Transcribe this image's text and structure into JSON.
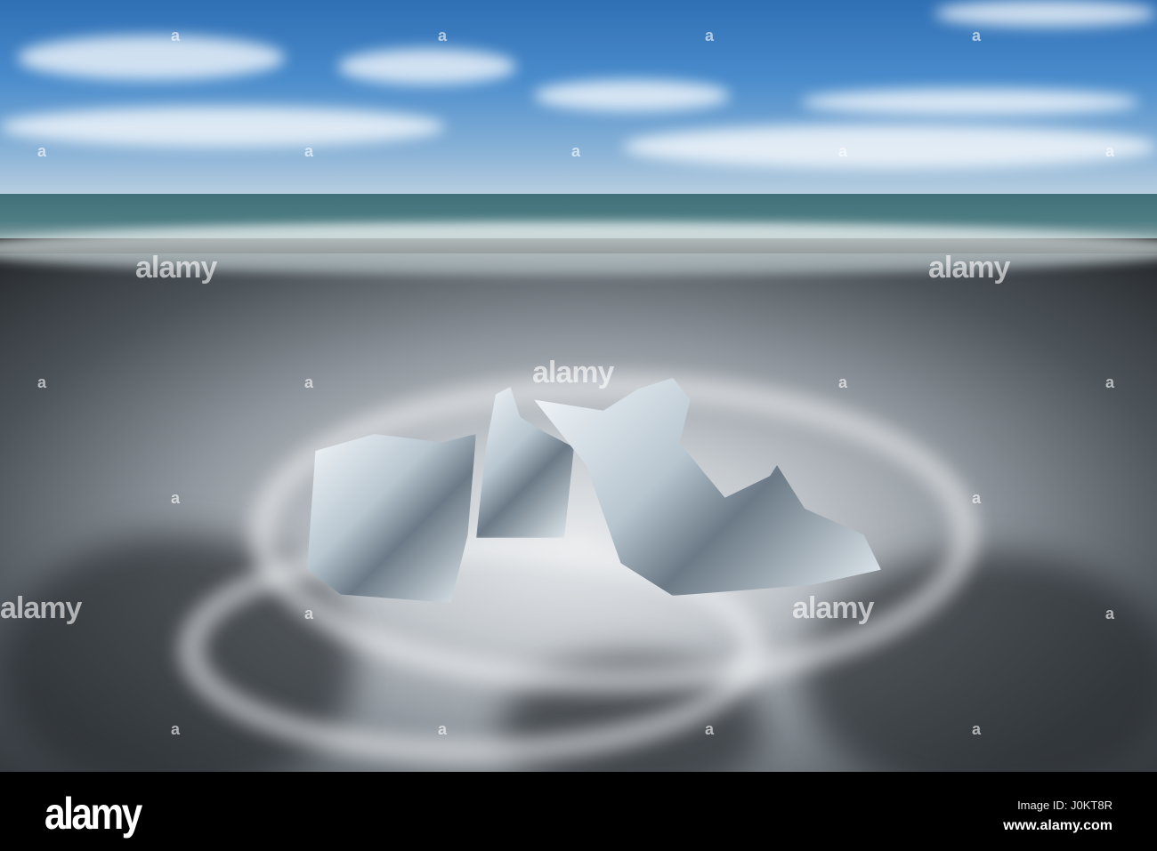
{
  "watermark": {
    "brand": "alamy",
    "small_mark": "a"
  },
  "footer": {
    "logo": "alamy",
    "image_id": "Image ID: J0KT8R",
    "url": "www.alamy.com"
  }
}
